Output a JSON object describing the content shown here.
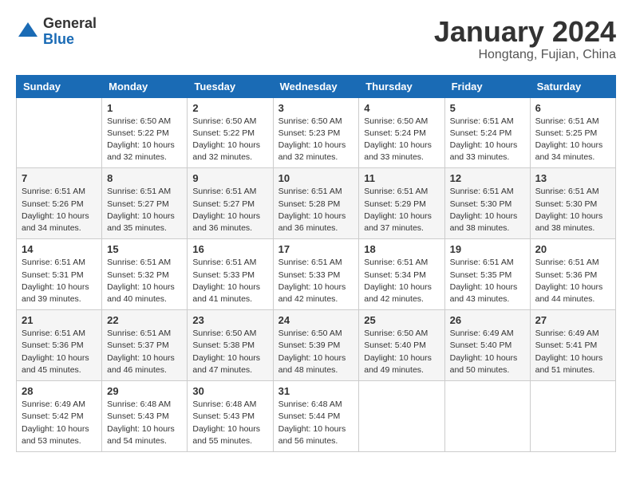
{
  "header": {
    "logo_general": "General",
    "logo_blue": "Blue",
    "title": "January 2024",
    "location": "Hongtang, Fujian, China"
  },
  "days_of_week": [
    "Sunday",
    "Monday",
    "Tuesday",
    "Wednesday",
    "Thursday",
    "Friday",
    "Saturday"
  ],
  "weeks": [
    [
      {
        "day": "",
        "info": ""
      },
      {
        "day": "1",
        "info": "Sunrise: 6:50 AM\nSunset: 5:22 PM\nDaylight: 10 hours\nand 32 minutes."
      },
      {
        "day": "2",
        "info": "Sunrise: 6:50 AM\nSunset: 5:22 PM\nDaylight: 10 hours\nand 32 minutes."
      },
      {
        "day": "3",
        "info": "Sunrise: 6:50 AM\nSunset: 5:23 PM\nDaylight: 10 hours\nand 32 minutes."
      },
      {
        "day": "4",
        "info": "Sunrise: 6:50 AM\nSunset: 5:24 PM\nDaylight: 10 hours\nand 33 minutes."
      },
      {
        "day": "5",
        "info": "Sunrise: 6:51 AM\nSunset: 5:24 PM\nDaylight: 10 hours\nand 33 minutes."
      },
      {
        "day": "6",
        "info": "Sunrise: 6:51 AM\nSunset: 5:25 PM\nDaylight: 10 hours\nand 34 minutes."
      }
    ],
    [
      {
        "day": "7",
        "info": "Sunrise: 6:51 AM\nSunset: 5:26 PM\nDaylight: 10 hours\nand 34 minutes."
      },
      {
        "day": "8",
        "info": "Sunrise: 6:51 AM\nSunset: 5:27 PM\nDaylight: 10 hours\nand 35 minutes."
      },
      {
        "day": "9",
        "info": "Sunrise: 6:51 AM\nSunset: 5:27 PM\nDaylight: 10 hours\nand 36 minutes."
      },
      {
        "day": "10",
        "info": "Sunrise: 6:51 AM\nSunset: 5:28 PM\nDaylight: 10 hours\nand 36 minutes."
      },
      {
        "day": "11",
        "info": "Sunrise: 6:51 AM\nSunset: 5:29 PM\nDaylight: 10 hours\nand 37 minutes."
      },
      {
        "day": "12",
        "info": "Sunrise: 6:51 AM\nSunset: 5:30 PM\nDaylight: 10 hours\nand 38 minutes."
      },
      {
        "day": "13",
        "info": "Sunrise: 6:51 AM\nSunset: 5:30 PM\nDaylight: 10 hours\nand 38 minutes."
      }
    ],
    [
      {
        "day": "14",
        "info": "Sunrise: 6:51 AM\nSunset: 5:31 PM\nDaylight: 10 hours\nand 39 minutes."
      },
      {
        "day": "15",
        "info": "Sunrise: 6:51 AM\nSunset: 5:32 PM\nDaylight: 10 hours\nand 40 minutes."
      },
      {
        "day": "16",
        "info": "Sunrise: 6:51 AM\nSunset: 5:33 PM\nDaylight: 10 hours\nand 41 minutes."
      },
      {
        "day": "17",
        "info": "Sunrise: 6:51 AM\nSunset: 5:33 PM\nDaylight: 10 hours\nand 42 minutes."
      },
      {
        "day": "18",
        "info": "Sunrise: 6:51 AM\nSunset: 5:34 PM\nDaylight: 10 hours\nand 42 minutes."
      },
      {
        "day": "19",
        "info": "Sunrise: 6:51 AM\nSunset: 5:35 PM\nDaylight: 10 hours\nand 43 minutes."
      },
      {
        "day": "20",
        "info": "Sunrise: 6:51 AM\nSunset: 5:36 PM\nDaylight: 10 hours\nand 44 minutes."
      }
    ],
    [
      {
        "day": "21",
        "info": "Sunrise: 6:51 AM\nSunset: 5:36 PM\nDaylight: 10 hours\nand 45 minutes."
      },
      {
        "day": "22",
        "info": "Sunrise: 6:51 AM\nSunset: 5:37 PM\nDaylight: 10 hours\nand 46 minutes."
      },
      {
        "day": "23",
        "info": "Sunrise: 6:50 AM\nSunset: 5:38 PM\nDaylight: 10 hours\nand 47 minutes."
      },
      {
        "day": "24",
        "info": "Sunrise: 6:50 AM\nSunset: 5:39 PM\nDaylight: 10 hours\nand 48 minutes."
      },
      {
        "day": "25",
        "info": "Sunrise: 6:50 AM\nSunset: 5:40 PM\nDaylight: 10 hours\nand 49 minutes."
      },
      {
        "day": "26",
        "info": "Sunrise: 6:49 AM\nSunset: 5:40 PM\nDaylight: 10 hours\nand 50 minutes."
      },
      {
        "day": "27",
        "info": "Sunrise: 6:49 AM\nSunset: 5:41 PM\nDaylight: 10 hours\nand 51 minutes."
      }
    ],
    [
      {
        "day": "28",
        "info": "Sunrise: 6:49 AM\nSunset: 5:42 PM\nDaylight: 10 hours\nand 53 minutes."
      },
      {
        "day": "29",
        "info": "Sunrise: 6:48 AM\nSunset: 5:43 PM\nDaylight: 10 hours\nand 54 minutes."
      },
      {
        "day": "30",
        "info": "Sunrise: 6:48 AM\nSunset: 5:43 PM\nDaylight: 10 hours\nand 55 minutes."
      },
      {
        "day": "31",
        "info": "Sunrise: 6:48 AM\nSunset: 5:44 PM\nDaylight: 10 hours\nand 56 minutes."
      },
      {
        "day": "",
        "info": ""
      },
      {
        "day": "",
        "info": ""
      },
      {
        "day": "",
        "info": ""
      }
    ]
  ]
}
